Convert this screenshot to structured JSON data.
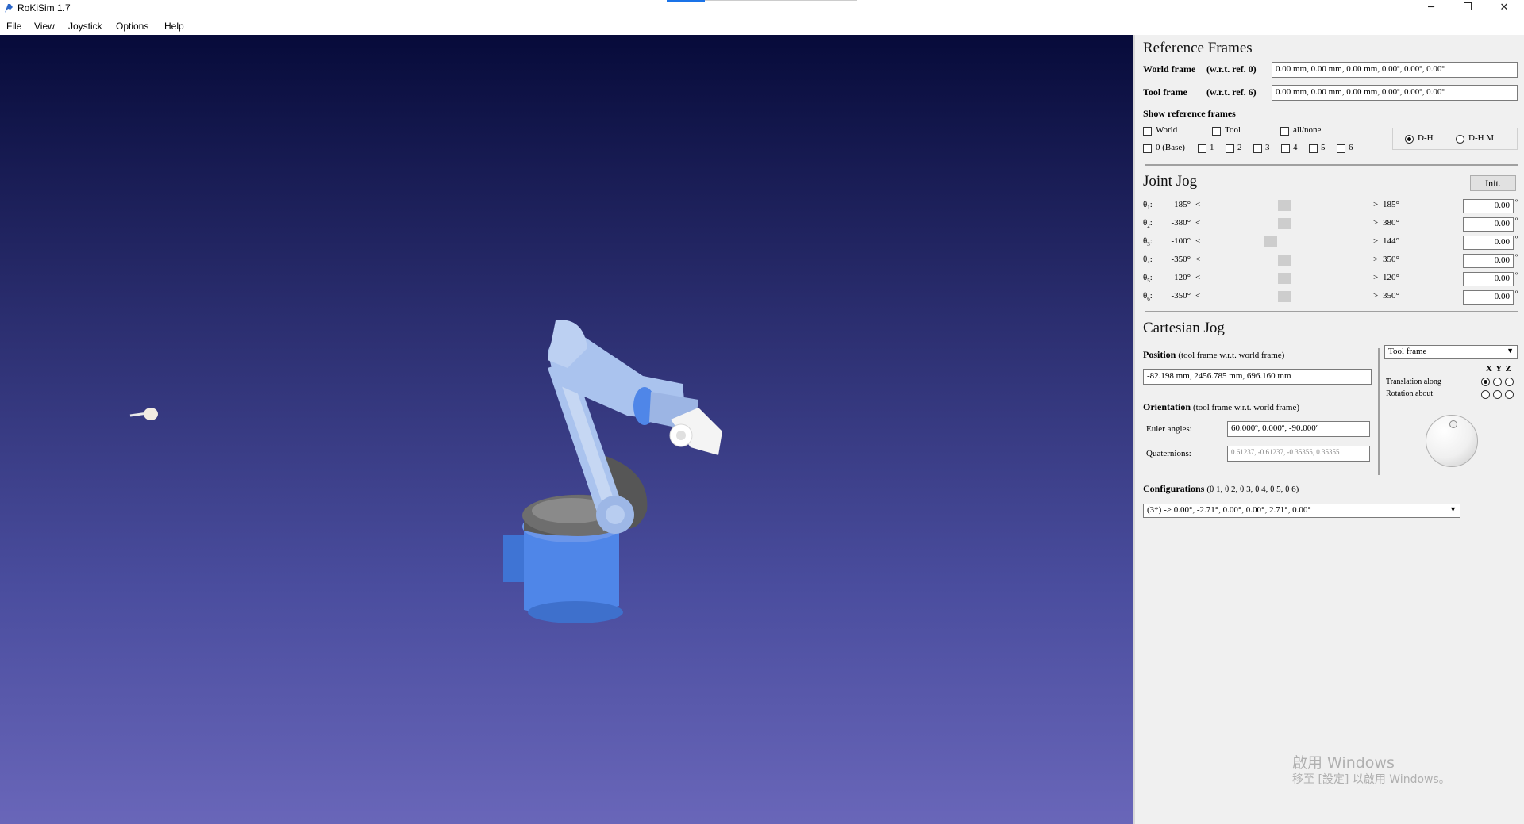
{
  "window": {
    "title": "RoKiSim 1.7",
    "minimize": "─",
    "maximize": "❐",
    "close": "✕"
  },
  "menu": [
    "File",
    "View",
    "Joystick",
    "Options",
    "Help"
  ],
  "reference_frames": {
    "heading": "Reference Frames",
    "world_label": "World frame",
    "world_ref": "(w.r.t. ref. 0)",
    "world_value": "0.00 mm, 0.00 mm, 0.00 mm, 0.00º, 0.00º, 0.00º",
    "tool_label": "Tool frame",
    "tool_ref": "(w.r.t. ref. 6)",
    "tool_value": "0.00 mm, 0.00 mm, 0.00 mm, 0.00º, 0.00º, 0.00º",
    "show_label": "Show reference frames",
    "checks_row1": [
      "World",
      "Tool",
      "all/none"
    ],
    "checks_row2": [
      "0 (Base)",
      "1",
      "2",
      "3",
      "4",
      "5",
      "6"
    ],
    "dh": "D-H",
    "dhm": "D-H M"
  },
  "joint_jog": {
    "heading": "Joint Jog",
    "init": "Init.",
    "theta": "θ",
    "lt": "<",
    "gt": ">",
    "deg": "º",
    "joints": [
      {
        "sub": "1",
        "min": "-185°",
        "max": "185°",
        "value": "0.00",
        "pos": 0.5
      },
      {
        "sub": "2",
        "min": "-380°",
        "max": "380°",
        "value": "0.00",
        "pos": 0.5
      },
      {
        "sub": "3",
        "min": "-100°",
        "max": "144°",
        "value": "0.00",
        "pos": 0.41
      },
      {
        "sub": "4",
        "min": "-350°",
        "max": "350°",
        "value": "0.00",
        "pos": 0.5
      },
      {
        "sub": "5",
        "min": "-120°",
        "max": "120°",
        "value": "0.00",
        "pos": 0.5
      },
      {
        "sub": "6",
        "min": "-350°",
        "max": "350°",
        "value": "0.00",
        "pos": 0.5
      }
    ]
  },
  "cartesian_jog": {
    "heading": "Cartesian Jog",
    "position_label": "Position",
    "position_note": "(tool frame w.r.t. world frame)",
    "position_value": "-82.198 mm, 2456.785 mm, 696.160 mm",
    "orientation_label": "Orientation",
    "orientation_note": "(tool frame w.r.t. world frame)",
    "euler_label": "Euler angles:",
    "euler_value": "60.000º, 0.000º, -90.000º",
    "quat_label": "Quaternions:",
    "quat_value": "0.61237, -0.61237, -0.35355, 0.35355",
    "frame_select": "Tool frame",
    "xyz": "X Y Z",
    "translation": "Translation along",
    "rotation": "Rotation about",
    "configurations_label": "Configurations",
    "configurations_thetas": "(θ 1, θ 2, θ 3, θ 4, θ 5, θ 6)",
    "configuration_value": "(3*) -> 0.00°, -2.71°, 0.00°, 0.00°, 2.71°, 0.00°"
  },
  "watermark": {
    "line1": "啟用 Windows",
    "line2": "移至 [設定] 以啟用 Windows。"
  },
  "colors": {
    "robot_body": "#aac3ee",
    "robot_base": "#4f86e8",
    "robot_gray": "#707070"
  }
}
